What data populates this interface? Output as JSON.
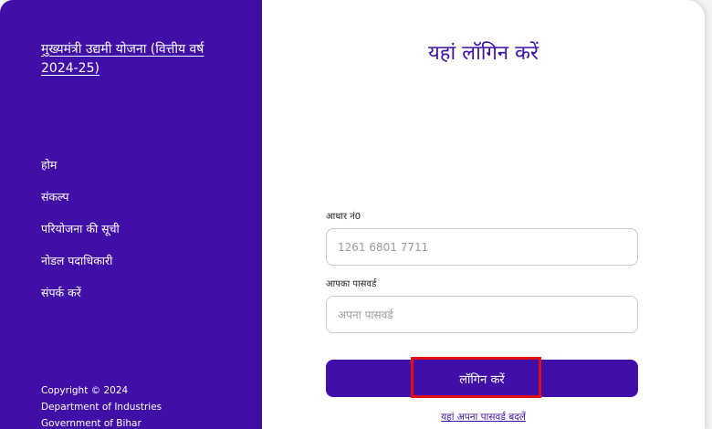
{
  "sidebar": {
    "title": "मुख्यमंत्री उद्यमी योजना (वित्तीय वर्ष 2024-25)",
    "nav": [
      {
        "label": "होम"
      },
      {
        "label": "संकल्प"
      },
      {
        "label": "परियोजना की सूची"
      },
      {
        "label": "नोडल पदाधिकारी"
      },
      {
        "label": "संपर्क करें"
      }
    ],
    "footer": {
      "copyright": "Copyright © 2024",
      "department": "Department of Industries",
      "government": "Government of Bihar"
    }
  },
  "login": {
    "heading": "यहां लॉगिन करें",
    "aadhaar_label": "आधार नं0",
    "aadhaar_placeholder": "1261 6801 7711",
    "password_label": "आपका पासवर्ड",
    "password_placeholder": "अपना पासवर्ड",
    "login_button": "लॉगिन करें",
    "change_password_link": "यहां अपना पासवर्ड बदलें"
  },
  "colors": {
    "brand": "#3f0fa8",
    "highlight": "#e01010",
    "background": "#ffffff"
  }
}
